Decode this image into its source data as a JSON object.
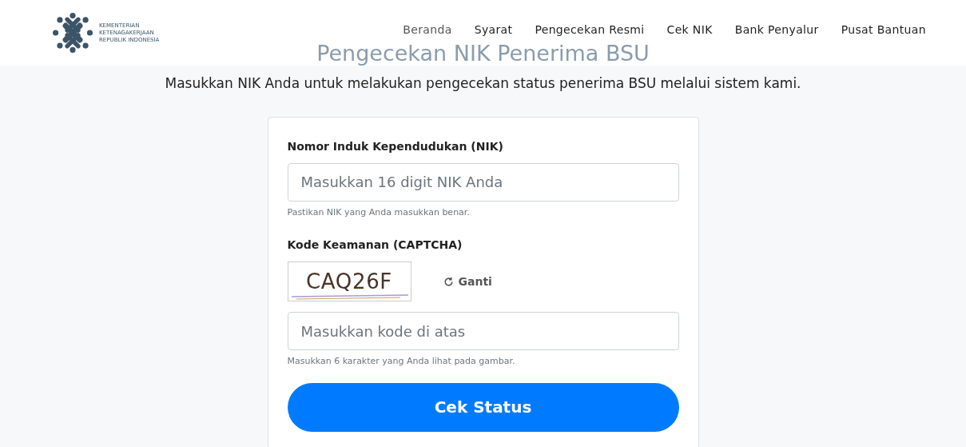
{
  "header": {
    "logo_lines": [
      "KEMENTERIAN",
      "KETENAGAKERJAAN",
      "REPUBLIK INDONESIA"
    ],
    "nav": [
      {
        "label": "Beranda",
        "selected": true
      },
      {
        "label": "Syarat",
        "selected": false
      },
      {
        "label": "Pengecekan Resmi",
        "selected": false
      },
      {
        "label": "Cek NIK",
        "selected": false
      },
      {
        "label": "Bank Penyalur",
        "selected": false
      },
      {
        "label": "Pusat Bantuan",
        "selected": false
      }
    ]
  },
  "page": {
    "title": "Pengecekan NIK Penerima BSU",
    "subtitle": "Masukkan NIK Anda untuk melakukan pengecekan status penerima BSU melalui sistem kami."
  },
  "form": {
    "nik": {
      "label": "Nomor Induk Kependudukan (NIK)",
      "placeholder": "Masukkan 16 digit NIK Anda",
      "hint": "Pastikan NIK yang Anda masukkan benar."
    },
    "captcha": {
      "label": "Kode Keamanan (CAPTCHA)",
      "code": "CAQ26F",
      "refresh": "Ganti",
      "placeholder": "Masukkan kode di atas",
      "hint": "Masukkan 6 karakter yang Anda lihat pada gambar."
    },
    "submit": "Cek Status"
  }
}
